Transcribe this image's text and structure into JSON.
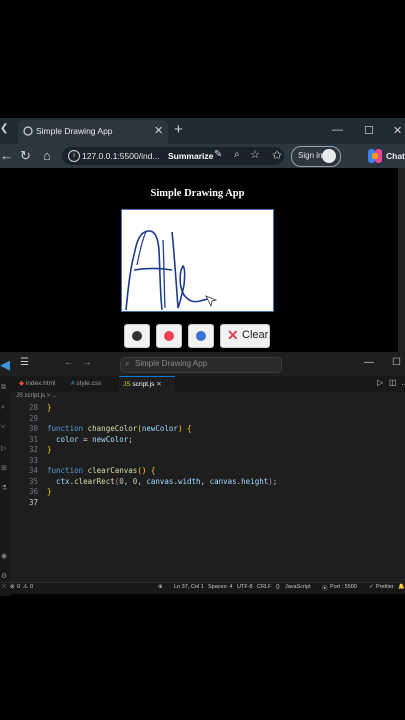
{
  "browser": {
    "tab_title": "Simple Drawing App",
    "url": "127.0.0.1:5500/ind...",
    "summarize_label": "Summarize",
    "signin_label": "Sign in",
    "chat_label": "Chat"
  },
  "app": {
    "title": "Simple Drawing App",
    "clear_label": "Clear",
    "color_buttons": [
      {
        "name": "black",
        "color": "#333333"
      },
      {
        "name": "red",
        "color": "#f03e55"
      },
      {
        "name": "blue",
        "color": "#3a6fd8"
      }
    ]
  },
  "editor": {
    "search_placeholder": "Simple Drawing App",
    "tabs": [
      "index.html",
      "style.css",
      "script.js"
    ],
    "active_tab": "script.js",
    "breadcrumb": "JS script.js > ...",
    "lines": [
      {
        "n": "28",
        "code": "}"
      },
      {
        "n": "29",
        "code": ""
      },
      {
        "n": "30",
        "code": "function changeColor(newColor) {"
      },
      {
        "n": "31",
        "code": "  color = newColor;"
      },
      {
        "n": "32",
        "code": "}"
      },
      {
        "n": "33",
        "code": ""
      },
      {
        "n": "34",
        "code": "function clearCanvas() {"
      },
      {
        "n": "35",
        "code": "  ctx.clearRect(0, 0, canvas.width, canvas.height);"
      },
      {
        "n": "36",
        "code": "}"
      },
      {
        "n": "37",
        "code": ""
      }
    ]
  },
  "status": {
    "errors": "0",
    "warnings": "0",
    "position": "Ln 37, Col 1",
    "spaces": "Spaces: 4",
    "encoding": "UTF-8",
    "eol": "CRLF",
    "language": "JavaScript",
    "port": "Port : 5500",
    "prettier": "Prettier"
  },
  "icons": [
    "tab-list-icon",
    "favicon-icon",
    "close-icon",
    "new-tab-icon",
    "back-icon",
    "refresh-icon",
    "home-icon",
    "info-icon",
    "search-icon",
    "star-icon",
    "favorites-icon",
    "avatar-icon",
    "copilot-icon",
    "vscode-logo-icon"
  ]
}
